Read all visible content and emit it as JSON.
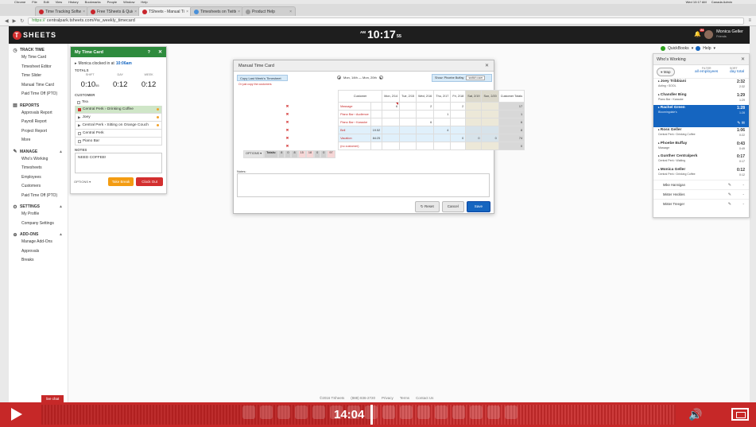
{
  "os_menu": {
    "items": [
      "Chrome",
      "File",
      "Edit",
      "View",
      "History",
      "Bookmarks",
      "People",
      "Window",
      "Help"
    ],
    "right": [
      "Wed 10:17 AM",
      "Canada Admin"
    ]
  },
  "browser": {
    "tabs": [
      {
        "label": "Time Tracking Software Co",
        "icon": "red"
      },
      {
        "label": "Free TSheets & QuickBooks",
        "icon": "red"
      },
      {
        "label": "TSheets - Manual Time C",
        "icon": "red",
        "active": true
      },
      {
        "label": "Timesheets on Twitter | L",
        "icon": "blue"
      },
      {
        "label": "Product Help",
        "icon": "grey"
      }
    ],
    "url_secure": "https://",
    "url": "centralpark.tsheets.com/#w_weekly_timecard"
  },
  "header": {
    "logo": "SHEETS",
    "logo_letter": "T",
    "clock_ampm": "AM",
    "clock_time": "10:17",
    "clock_seconds": "55",
    "notification_count": "24",
    "user_name": "Monica Geller",
    "user_role": "Friends"
  },
  "sidebar": {
    "track": {
      "title": "TRACK TIME",
      "items": [
        "My Time Card",
        "Timesheet Editor",
        "Time Slider",
        "Manual Time Card",
        "Paid Time Off (PTO)"
      ]
    },
    "reports": {
      "title": "REPORTS",
      "items": [
        "Approvals Report",
        "Payroll Report",
        "Project Report",
        "More"
      ]
    },
    "manage": {
      "title": "MANAGE",
      "items": [
        "Who's Working",
        "Timesheets",
        "Employees",
        "Customers",
        "Paid Time Off (PTO)"
      ]
    },
    "settings": {
      "title": "SETTINGS",
      "items": [
        "My Profile",
        "Company Settings"
      ]
    },
    "addons": {
      "title": "ADD-ONS",
      "items": [
        "Manage Add-Ons",
        "Approvals",
        "Breaks"
      ]
    }
  },
  "my_time_card": {
    "title": "My Time Card",
    "help": "?",
    "clocked_prefix": "Monica clocked in at",
    "clocked_time": "10:06am",
    "totals_label": "TOTALS",
    "shift_label": "SHIFT",
    "shift_value": "0:10",
    "shift_seconds": "55",
    "day_label": "DAY",
    "day_value": "0:12",
    "week_label": "WEEK",
    "week_value": "0:12",
    "customer_label": "CUSTOMER",
    "customers": [
      "Tea",
      "Central Perk › Drinking Coffee",
      "Joey",
      "Central Perk › Sitting on Orange Couch",
      "Central Perk",
      "Piano Bar"
    ],
    "notes_label": "NOTES",
    "notes": "NEED COFFEE!",
    "options": "OPTIONS ▾",
    "take_break": "Take Break",
    "clock_out": "Clock Out"
  },
  "manual_time_card": {
    "title": "Manual Time Card",
    "copy_button": "Copy Last Week's Timesheet",
    "copy_note": "Or just copy the customers",
    "date_range": "Mon, 14th — Mon, 20th",
    "show_label": "Show: Phoebe Buffay",
    "show_select": "switch user",
    "col_customer": "Customer",
    "days": [
      "Mon, 2/14",
      "Tue, 2/15",
      "Wed, 2/16",
      "Thu, 2/17",
      "Fri, 2/18",
      "Sat, 2/19",
      "Sun, 2/20"
    ],
    "col_total": "Customer Totals",
    "rows": [
      {
        "customer": "Massage",
        "hours": "",
        "vals": [
          "6",
          "",
          "2",
          "",
          "2",
          "",
          ""
        ],
        "total": "17",
        "flag": 0
      },
      {
        "customer": "Piano Bar › Audience",
        "hours": "",
        "vals": [
          "",
          "",
          "",
          "1",
          "",
          "",
          ""
        ],
        "total": "1",
        "flag": -1
      },
      {
        "customer": "Piano Bar › Karaoke",
        "hours": "",
        "vals": [
          "",
          "",
          "6",
          "",
          "",
          "",
          ""
        ],
        "total": "6",
        "flag": -1
      },
      {
        "customer": "Bell",
        "hours": "19.52",
        "vals": [
          "",
          "",
          "",
          "4",
          "",
          "",
          ""
        ],
        "total": "8",
        "flag": -1,
        "blue": true
      },
      {
        "customer": "Vacation",
        "hours": "84:25",
        "vals": [
          "",
          "",
          "",
          "",
          "0",
          "0",
          "0"
        ],
        "total": "74",
        "flag": -1,
        "blue": true
      },
      {
        "customer": "(no customer)",
        "hours": "",
        "vals": [
          "",
          "",
          "",
          "",
          "",
          "",
          ""
        ],
        "total": "0",
        "flag": -1
      }
    ],
    "options_label": "OPTIONS ▾",
    "totals_label": "Totals:",
    "totals": [
      "8",
      "0",
      "8",
      "15",
      "18",
      "0",
      "0"
    ],
    "grand_total": "97",
    "notes_label": "Notes:",
    "reset": "Reset",
    "cancel": "Cancel",
    "save": "Save"
  },
  "quickbooks_bar": {
    "quickbooks": "QuickBooks",
    "help": "Help"
  },
  "whos_working": {
    "title": "Who's Working",
    "map": "Map",
    "filter_label": "FILTER",
    "filter_value": "all employees",
    "sort_label": "SORT",
    "sort_value": "day total",
    "people": [
      {
        "name": "Joey Tribbiani",
        "status": "Acting › SOOL",
        "time": "2:32",
        "day": "2:32"
      },
      {
        "name": "Chandler Bing",
        "status": "Piano Bar › Karaoke",
        "time": "1:29",
        "day": "1:29"
      },
      {
        "name": "Rachel Green",
        "status": "Bloomingdale's",
        "time": "1:28",
        "day": "1:28",
        "selected": true
      },
      {
        "name": "Ross Geller",
        "status": "Central Perk › Drinking Coffee",
        "time": "1:06",
        "day": "0:22"
      },
      {
        "name": "Phoebe Buffay",
        "status": "Massage",
        "time": "0:43",
        "day": "0:49"
      },
      {
        "name": "Gunther Centralperk",
        "status": "Central Perk › Waiting",
        "time": "0:17",
        "day": "0:17"
      },
      {
        "name": "Monica Geller",
        "status": "Central Perk › Drinking Coffee",
        "time": "0:12",
        "day": "0:12"
      }
    ],
    "offline": [
      "Mike Hannigan",
      "Mister Heckles",
      "Mister Treeger"
    ],
    "offline_dash": "-"
  },
  "footer": {
    "copy": "©2016 TSheets",
    "phone": "(888) 836-2720",
    "privacy": "Privacy",
    "terms": "Terms",
    "contact": "Contact Us"
  },
  "live_chat": "live chat",
  "player": {
    "time": "14:04",
    "progress": 0.52
  },
  "colors": {
    "brand_red": "#d32f2f",
    "green": "#2e8b3d",
    "blue": "#1565c0",
    "player_red": "#c62828"
  }
}
